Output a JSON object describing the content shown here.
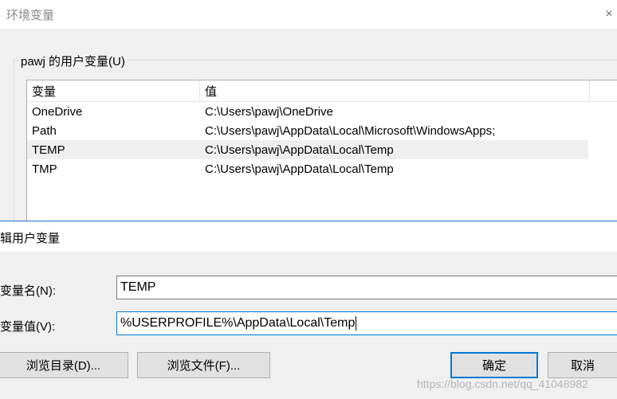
{
  "env_window": {
    "title": "环境变量",
    "close_glyph": "×",
    "user_group_label": "pawj 的用户变量(U)",
    "columns": [
      "变量",
      "值"
    ],
    "rows": [
      {
        "name": "OneDrive",
        "value": "C:\\Users\\pawj\\OneDrive",
        "selected": false
      },
      {
        "name": "Path",
        "value": "C:\\Users\\pawj\\AppData\\Local\\Microsoft\\WindowsApps;",
        "selected": false
      },
      {
        "name": "TEMP",
        "value": "C:\\Users\\pawj\\AppData\\Local\\Temp",
        "selected": true
      },
      {
        "name": "TMP",
        "value": "C:\\Users\\pawj\\AppData\\Local\\Temp",
        "selected": false
      }
    ]
  },
  "edit_dialog": {
    "title": "辑用户变量",
    "name_label": "变量名(N):",
    "name_value": "TEMP",
    "value_label": "变量值(V):",
    "value_value": "%USERPROFILE%\\AppData\\Local\\Temp",
    "buttons": {
      "browse_dir": "浏览目录(D)...",
      "browse_file": "浏览文件(F)...",
      "ok": "确定",
      "cancel": "取消"
    }
  },
  "watermark": "https://blog.csdn.net/qq_41048982",
  "colors": {
    "focus_blue": "#0078d7",
    "selected_row": "#efefef",
    "button_face": "#e1e1e1"
  }
}
